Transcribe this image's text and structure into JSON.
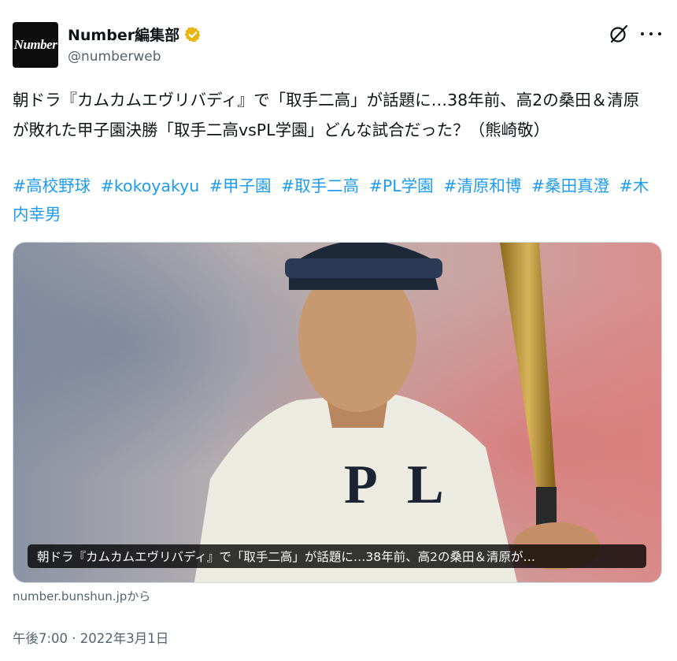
{
  "author": {
    "avatar_text": "Number",
    "display_name": "Number編集部",
    "handle": "@numberweb",
    "verified_icon": "gold-verified-badge-icon"
  },
  "actions": {
    "grok_icon": "grok-icon",
    "more_icon": "more-dots-icon"
  },
  "tweet": {
    "text": "朝ドラ『カムカムエヴリバディ』で「取手二高」が話題に…38年前、高2の桑田＆清原が敗れた甲子園決勝「取手二高vsPL学園」どんな試合だった？（熊崎敬）",
    "hashtags": [
      "#高校野球",
      "#kokoyakyu",
      "#甲子園",
      "#取手二高",
      "#PL学園",
      "#清原和博",
      "#桑田真澄",
      "#木内幸男"
    ]
  },
  "card": {
    "caption": "朝ドラ『カムカムエヴリバディ』で「取手二高」が話題に…38年前、高2の桑田＆清原が…",
    "source": "number.bunshun.jpから"
  },
  "timestamp": "午後7:00 · 2022年3月1日",
  "colors": {
    "text": "#0f1419",
    "secondary": "#536471",
    "link": "#1d9bf0",
    "badge": "#e8b512"
  }
}
